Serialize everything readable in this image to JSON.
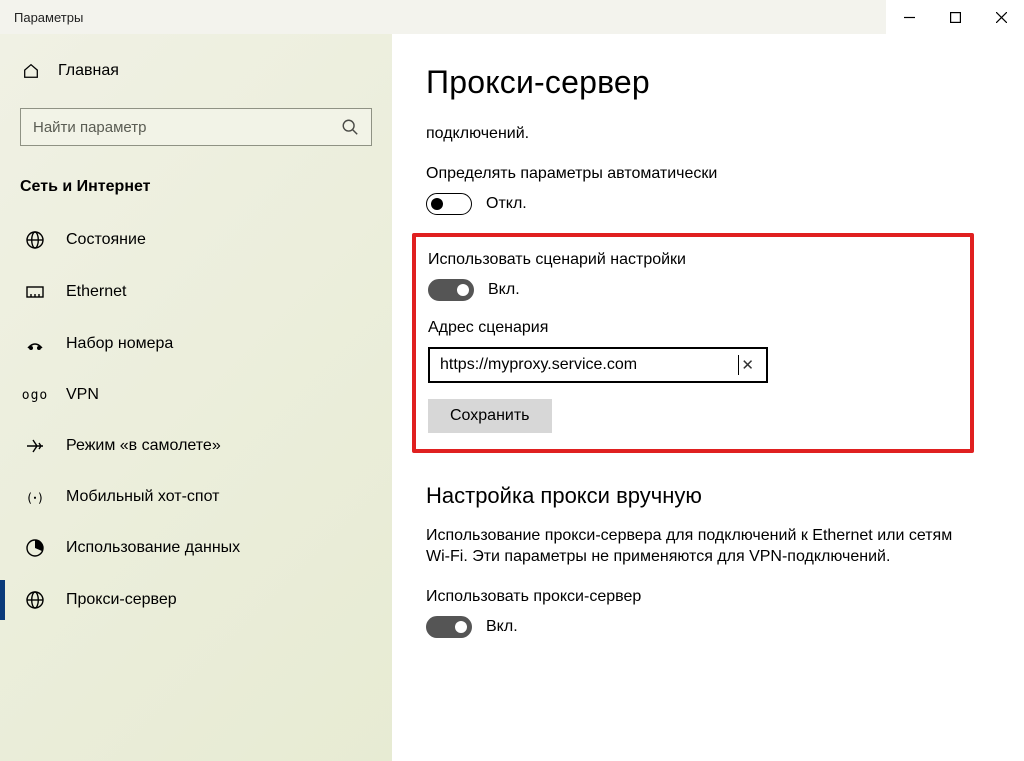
{
  "window": {
    "title": "Параметры"
  },
  "sidebar": {
    "home": "Главная",
    "search_placeholder": "Найти параметр",
    "category": "Сеть и Интернет",
    "items": [
      {
        "id": "status",
        "label": "Состояние"
      },
      {
        "id": "ethernet",
        "label": "Ethernet"
      },
      {
        "id": "dialup",
        "label": "Набор номера"
      },
      {
        "id": "vpn",
        "label": "VPN"
      },
      {
        "id": "airplane",
        "label": "Режим «в самолете»"
      },
      {
        "id": "hotspot",
        "label": "Мобильный хот-спот"
      },
      {
        "id": "datausage",
        "label": "Использование данных"
      },
      {
        "id": "proxy",
        "label": "Прокси-сервер"
      }
    ],
    "active_id": "proxy"
  },
  "content": {
    "title": "Прокси-сервер",
    "truncated_line": "подключений.",
    "auto_detect": {
      "label": "Определять параметры автоматически",
      "state": "Откл."
    },
    "script": {
      "label": "Использовать сценарий настройки",
      "state": "Вкл.",
      "address_label": "Адрес сценария",
      "address_value": "https://myproxy.service.com",
      "save": "Сохранить"
    },
    "manual": {
      "heading": "Настройка прокси вручную",
      "description": "Использование прокси-сервера для подключений к Ethernet или сетям Wi-Fi. Эти параметры не применяются для VPN-подключений.",
      "use_label": "Использовать прокси-сервер",
      "use_state": "Вкл."
    }
  }
}
